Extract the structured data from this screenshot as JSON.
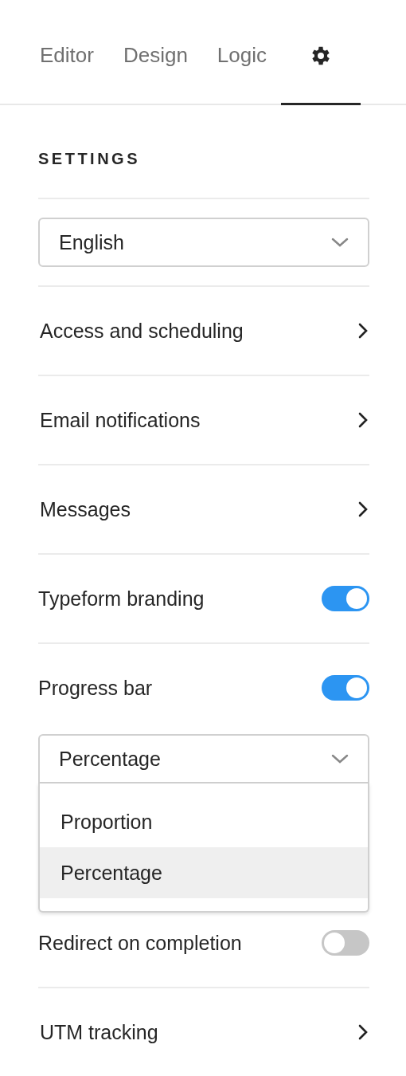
{
  "tabs": [
    {
      "kind": "text",
      "label": "Editor",
      "selected": false
    },
    {
      "kind": "text",
      "label": "Design",
      "selected": false
    },
    {
      "kind": "text",
      "label": "Logic",
      "selected": false
    },
    {
      "kind": "settings",
      "selected": true
    }
  ],
  "settings": {
    "heading": "SETTINGS",
    "language": {
      "value": "English"
    },
    "items": [
      {
        "kind": "link",
        "label": "Access and scheduling"
      },
      {
        "kind": "link",
        "label": "Email notifications"
      },
      {
        "kind": "link",
        "label": "Messages"
      },
      {
        "kind": "toggle",
        "label": "Typeform branding",
        "on": true
      },
      {
        "kind": "toggle",
        "label": "Progress bar",
        "on": true,
        "dropdown": {
          "value": "Percentage",
          "expanded": true,
          "options": [
            {
              "label": "Proportion",
              "selected": false
            },
            {
              "label": "Percentage",
              "selected": true
            }
          ]
        }
      },
      {
        "kind": "toggle",
        "label": "Redirect on completion",
        "on": false
      },
      {
        "kind": "link",
        "label": "UTM tracking"
      }
    ]
  }
}
